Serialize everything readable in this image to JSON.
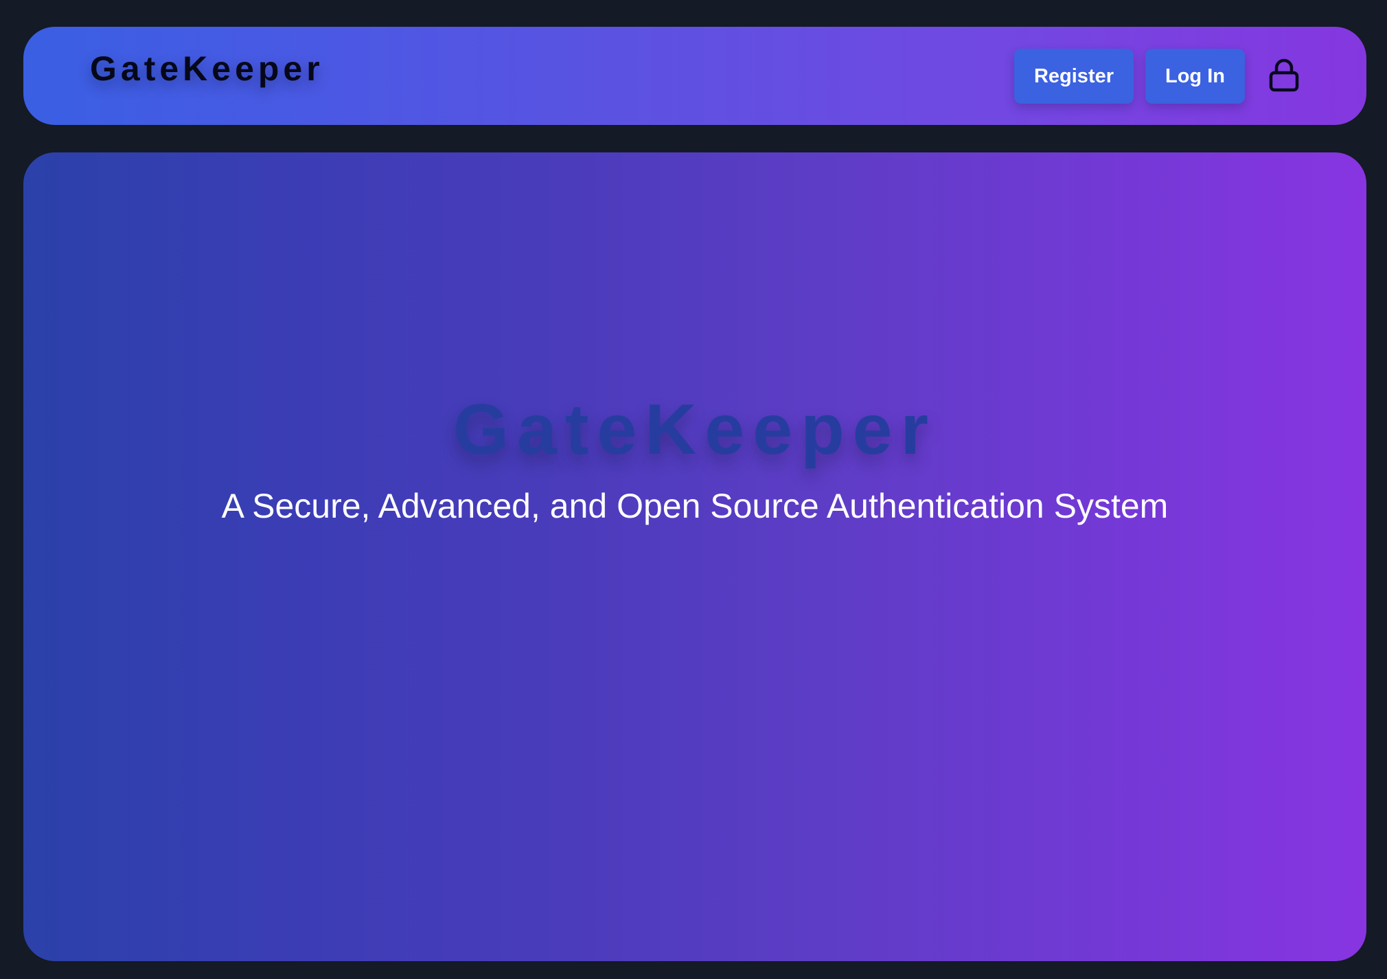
{
  "header": {
    "brand": "GateKeeper",
    "register_label": "Register",
    "login_label": "Log In",
    "lock_icon": "lock-icon"
  },
  "hero": {
    "title": "GateKeeper",
    "subtitle": "A Secure, Advanced, and Open Source Authentication System"
  },
  "colors": {
    "page_background": "#141a26",
    "nav_gradient_start": "#3a5fe3",
    "nav_gradient_end": "#8537df",
    "hero_gradient_start": "#2b41a9",
    "hero_gradient_end": "#8835e1",
    "button": "#3b62e0",
    "hero_title": "#263d9f"
  }
}
